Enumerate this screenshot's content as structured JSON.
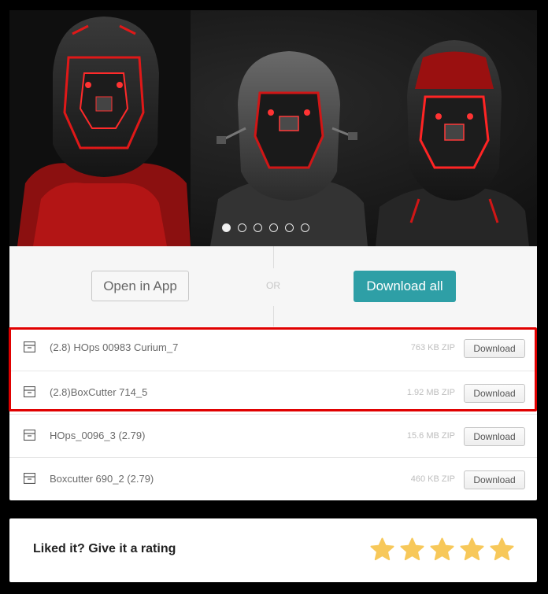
{
  "carousel": {
    "slide_count": 6,
    "active_index": 0
  },
  "actions": {
    "open_in_app": "Open in App",
    "or_text": "OR",
    "download_all": "Download all",
    "accent_color": "#2e9fa6"
  },
  "files": [
    {
      "name": "(2.8) HOps 00983 Curium_7",
      "size": "763 KB ZIP",
      "button": "Download"
    },
    {
      "name": "(2.8)BoxCutter 714_5",
      "size": "1.92 MB ZIP",
      "button": "Download"
    },
    {
      "name": "HOps_0096_3 (2.79)",
      "size": "15.6 MB ZIP",
      "button": "Download"
    },
    {
      "name": "Boxcutter 690_2 (2.79)",
      "size": "460 KB ZIP",
      "button": "Download"
    }
  ],
  "highlight_color": "#e00000",
  "rating": {
    "label": "Liked it? Give it a rating",
    "stars": 5,
    "star_color": "#f7c85a"
  }
}
